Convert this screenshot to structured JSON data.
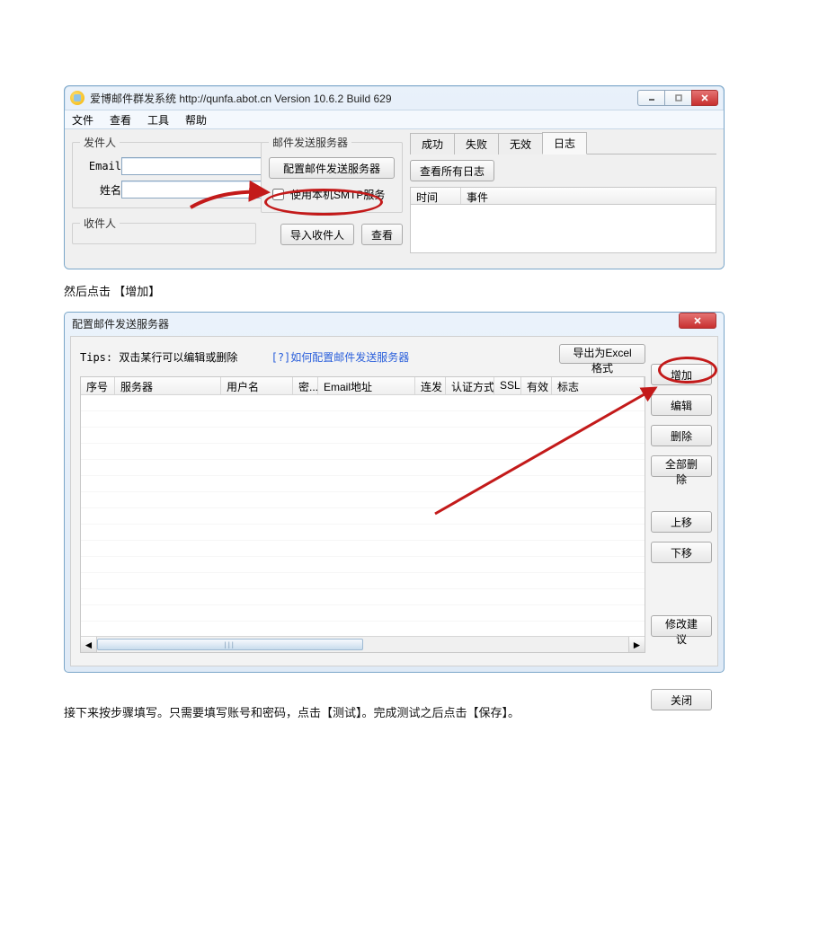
{
  "win1": {
    "title": "爱博邮件群发系统 http://qunfa.abot.cn Version 10.6.2 Build 629",
    "menu": [
      "文件",
      "查看",
      "工具",
      "帮助"
    ],
    "sender_legend": "发件人",
    "email_label": "Email",
    "name_label": "姓名",
    "recipient_legend": "收件人",
    "import_recipient": "导入收件人",
    "view": "查看",
    "smtp_legend": "邮件发送服务器",
    "config_btn": "配置邮件发送服务器",
    "local_smtp": "使用本机SMTP服务",
    "tabs": [
      "成功",
      "失败",
      "无效",
      "日志"
    ],
    "view_all_log": "查看所有日志",
    "col_time": "时间",
    "col_event": "事件"
  },
  "instr1": "然后点击 【增加】",
  "win2": {
    "title": "配置邮件发送服务器",
    "tips_prefix": "Tips: 双击某行可以编辑或删除",
    "tips_link": "如何配置邮件发送服务器",
    "export": "导出为Excel格式",
    "cols": [
      "序号",
      "服务器",
      "用户名",
      "密...",
      "Email地址",
      "连发",
      "认证方式",
      "SSL",
      "有效",
      "标志"
    ],
    "btns": {
      "add": "增加",
      "edit": "编辑",
      "delete": "删除",
      "delete_all": "全部删除",
      "move_up": "上移",
      "move_down": "下移",
      "suggest": "修改建议",
      "close": "关闭"
    }
  },
  "instr2": "接下来按步骤填写。只需要填写账号和密码，点击【测试】。完成测试之后点击【保存】。"
}
